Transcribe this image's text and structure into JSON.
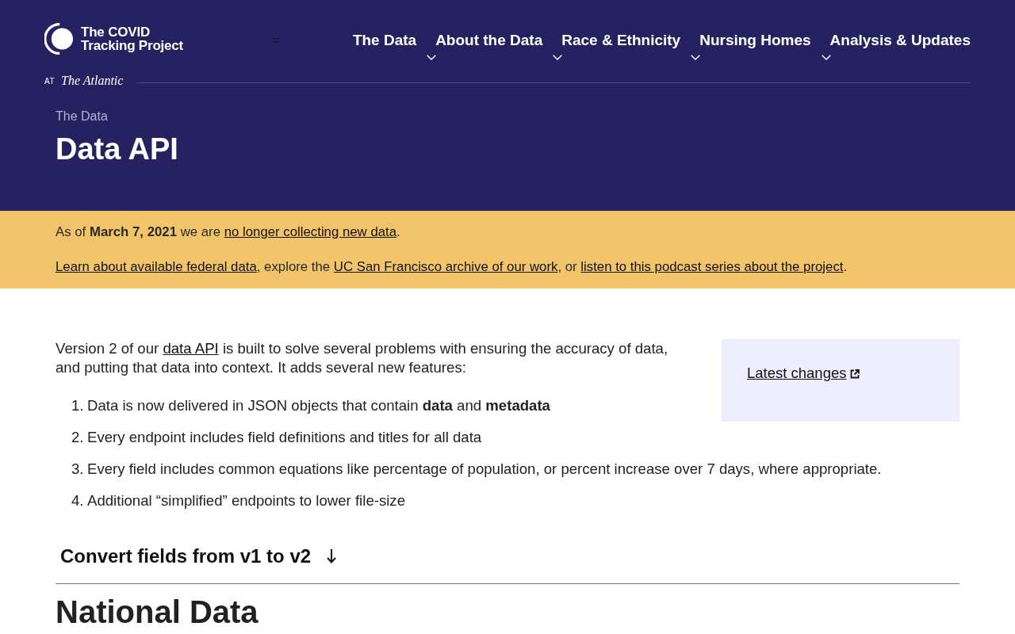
{
  "header": {
    "logo": {
      "name_line_1": "The COVID",
      "name_line_2": "Tracking Project",
      "at": "AT",
      "partner": "The Atlantic"
    },
    "nav": [
      {
        "label": "The Data",
        "expandable": true
      },
      {
        "label": "About the Data",
        "expandable": true
      },
      {
        "label": "Race & Ethnicity",
        "expandable": true
      },
      {
        "label": "Nursing Homes",
        "expandable": true
      },
      {
        "label": "Analysis & Updates",
        "expandable": false
      }
    ],
    "breadcrumb": "The Data",
    "title": "Data API"
  },
  "notice": {
    "lines": [
      [
        {
          "kind": "text",
          "text": "As of **March 7, 2021** we are "
        },
        {
          "kind": "link",
          "text": "no longer collecting new data"
        },
        {
          "kind": "text",
          "text": "."
        }
      ],
      [
        {
          "kind": "link",
          "text": "Learn about available federal data"
        },
        {
          "kind": "text",
          "text": ", explore the "
        },
        {
          "kind": "link",
          "text": "UC San Francisco archive of our work"
        },
        {
          "kind": "text",
          "text": ", or "
        },
        {
          "kind": "link",
          "text": "listen to this podcast series about the project"
        },
        {
          "kind": "text",
          "text": "."
        }
      ]
    ]
  },
  "sidebar": {
    "link": "Latest changes"
  },
  "intro": [
    {
      "kind": "text",
      "text": "Version 2 of our "
    },
    {
      "kind": "link",
      "text": "data API"
    },
    {
      "kind": "text",
      "text": " is built to solve several problems with ensuring the accuracy of data, and putting that data into context. It adds several new features:"
    }
  ],
  "features": [
    {
      "number": "1.",
      "text": "Data is now delivered in JSON objects that contain **data** and **metadata**"
    },
    {
      "number": "2.",
      "text": "Every endpoint includes field definitions and titles for all data"
    },
    {
      "number": "3.",
      "text": "Every field includes common equations like percentage of population, or percent increase over 7 days, where appropriate."
    },
    {
      "number": "4.",
      "text": "Additional “simplified” endpoints to lower file-size"
    }
  ],
  "toggle": {
    "label": "Convert fields from v1 to v2",
    "expanded": false
  },
  "section_heading": "National Data"
}
